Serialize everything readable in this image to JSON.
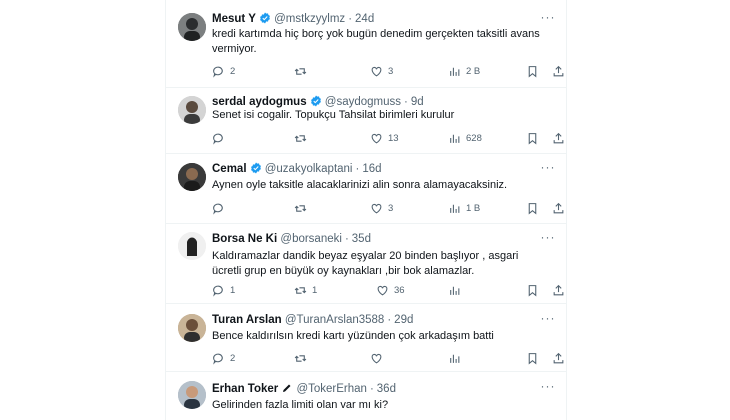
{
  "colors": {
    "verified": "#1d9bf0",
    "text": "#0f1419",
    "muted": "#536471",
    "divider": "#eff3f4"
  },
  "tweets": [
    {
      "name": "Mesut Y",
      "badge": "verified",
      "handle": "@mstkzyylmz",
      "time": "24d",
      "text": "kredi kartımda hiç borç yok bugün denedim gerçekten taksitli avans vermiyor.",
      "replies": "2",
      "retweets": "",
      "likes": "3",
      "views": "2 B"
    },
    {
      "name": "serdal aydogmus",
      "badge": "verified",
      "handle": "@saydogmuss",
      "time": "9d",
      "text": "Senet isi cogalir. Topukçu Tahsilat birimleri kurulur",
      "replies": "",
      "retweets": "",
      "likes": "13",
      "views": "628"
    },
    {
      "name": "Cemal",
      "badge": "verified",
      "handle": "@uzakyolkaptani",
      "time": "16d",
      "text": "Aynen oyle taksitle alacaklarinizi alin sonra alamayacaksiniz.",
      "replies": "",
      "retweets": "",
      "likes": "3",
      "views": "1 B"
    },
    {
      "name": "Borsa Ne Ki",
      "badge": "",
      "handle": "@borsaneki",
      "time": "35d",
      "text": "Kaldıramazlar dandik beyaz eşyalar 20 binden başlıyor , asgari ücretli grup en büyük oy kaynakları ,bir bok alamazlar.",
      "replies": "1",
      "retweets": "1",
      "likes": "36",
      "views": ""
    },
    {
      "name": "Turan Arslan",
      "badge": "",
      "handle": "@TuranArslan3588",
      "time": "29d",
      "text": "Bence kaldırılsın kredi kartı yüzünden çok arkadaşım batti",
      "replies": "2",
      "retweets": "",
      "likes": "",
      "views": ""
    },
    {
      "name": "Erhan Toker",
      "badge": "pen",
      "handle": "@TokerErhan",
      "time": "36d",
      "text": "Gelirinden fazla limiti olan var mı ki?",
      "replies": "",
      "retweets": "",
      "likes": "",
      "views": ""
    }
  ]
}
